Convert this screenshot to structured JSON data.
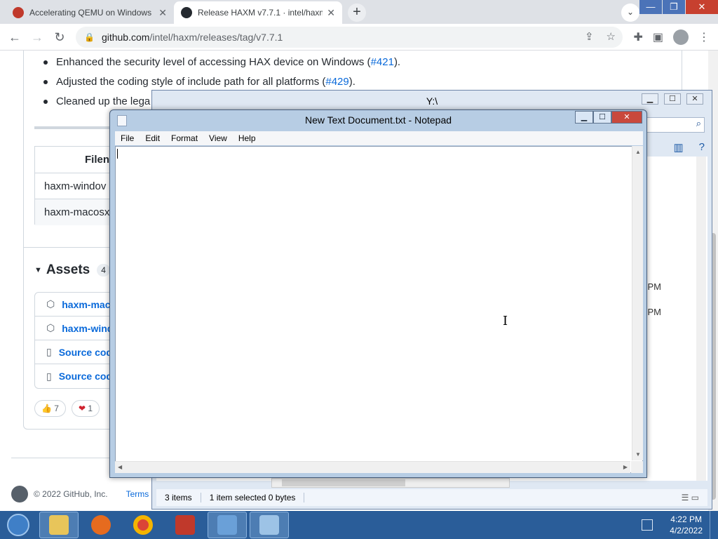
{
  "browser": {
    "tabs": [
      {
        "title": "Accelerating QEMU on Windows",
        "active": false
      },
      {
        "title": "Release HAXM v7.7.1 · intel/haxm",
        "active": true
      }
    ],
    "close_glyph": "✕",
    "new_tab_glyph": "+",
    "url_host": "github.com",
    "url_path": "/intel/haxm/releases/tag/v7.7.1"
  },
  "page": {
    "bullets": [
      {
        "text": "Enhanced the security level of accessing HAX device on Windows (",
        "link": "#421",
        "suffix": ")."
      },
      {
        "text": "Adjusted the coding style of include path for all platforms (",
        "link": "#429",
        "suffix": ")."
      },
      {
        "text": "Cleaned up the lega",
        "link": "",
        "suffix": ""
      }
    ],
    "files_table": {
      "header": "Filen",
      "rows": [
        "haxm-windov",
        "haxm-macosx"
      ]
    },
    "assets": {
      "title": "Assets",
      "count": "4",
      "items": [
        {
          "icon": "package-icon",
          "label": "haxm-mac"
        },
        {
          "icon": "package-icon",
          "label": "haxm-wind"
        },
        {
          "icon": "file-zip-icon",
          "label": "Source cod"
        },
        {
          "icon": "file-zip-icon",
          "label": "Source cod"
        }
      ]
    },
    "reactions": [
      {
        "emoji": "👍",
        "count": "7"
      },
      {
        "emoji": "❤",
        "count": "1"
      }
    ],
    "footer": {
      "copyright": "© 2022 GitHub, Inc.",
      "terms": "Terms"
    }
  },
  "explorer": {
    "title": "Y:\\",
    "times": [
      "PM",
      "PM"
    ],
    "status": {
      "items": "3 items",
      "selected": "1 item selected  0 bytes"
    }
  },
  "notepad": {
    "title": "New Text Document.txt - Notepad",
    "menu": [
      "File",
      "Edit",
      "Format",
      "View",
      "Help"
    ],
    "content": ""
  },
  "taskbar": {
    "apps": [
      {
        "name": "file-explorer-icon",
        "color": "#e8c55a"
      },
      {
        "name": "firefox-icon",
        "color": "#e66b1f"
      },
      {
        "name": "chrome-icon",
        "color": "#db4437"
      },
      {
        "name": "toolbox-icon",
        "color": "#c0392b"
      },
      {
        "name": "control-panel-icon",
        "color": "#6aa0d8"
      },
      {
        "name": "notepad-icon",
        "color": "#9dc3e6"
      }
    ],
    "time": "4:22 PM",
    "date": "4/2/2022"
  },
  "colors": {
    "link": "#0969da",
    "taskbar": "#2a5d99",
    "close_red": "#c9483c"
  }
}
